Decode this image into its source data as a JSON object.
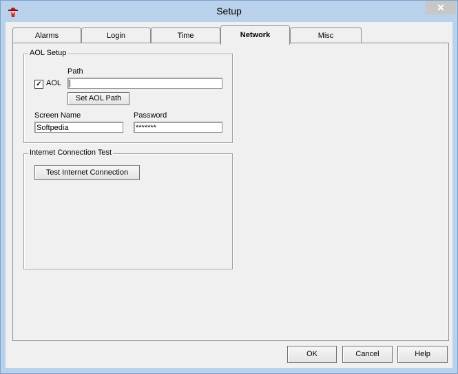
{
  "window": {
    "title": "Setup",
    "close_glyph": "✕"
  },
  "tabs": [
    {
      "label": "Alarms"
    },
    {
      "label": "Login"
    },
    {
      "label": "Time"
    },
    {
      "label": "Network"
    },
    {
      "label": "Misc"
    }
  ],
  "active_tab": "Network",
  "aol_setup": {
    "title": "AOL Setup",
    "aol_checkbox": {
      "label": "AOL",
      "checked": true,
      "glyph": "✓"
    },
    "path_label": "Path",
    "path_value": "",
    "set_path_button": "Set AOL Path",
    "screen_name_label": "Screen Name",
    "screen_name_value": "Softpedia",
    "password_label": "Password",
    "password_value": "*******"
  },
  "internet_test": {
    "title": "Internet Connection Test",
    "test_button": "Test Internet Connection"
  },
  "footer": {
    "ok_label": "OK",
    "cancel_label": "Cancel",
    "help_label": "Help"
  },
  "icons": {
    "app": "spy-hat-icon",
    "close": "close-icon"
  },
  "colors": {
    "frame": "#b9d1ea",
    "dialog_bg": "#f0f0f0",
    "close_button": "#c7c7c7"
  }
}
